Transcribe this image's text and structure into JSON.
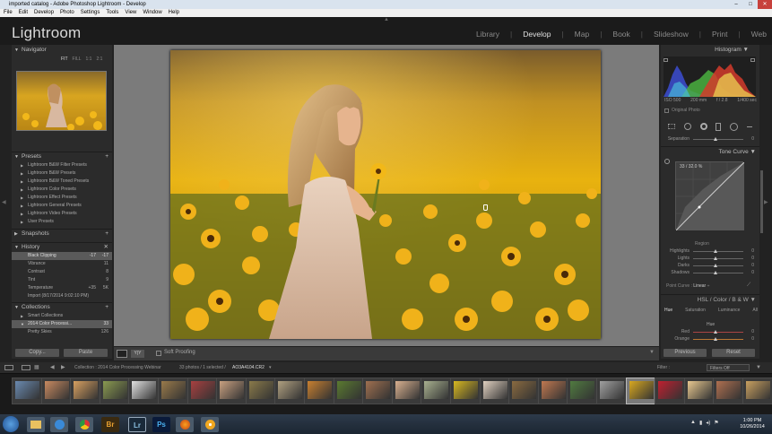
{
  "window": {
    "title": "imported catalog - Adobe Photoshop Lightroom - Develop"
  },
  "menu": [
    "File",
    "Edit",
    "Develop",
    "Photo",
    "Settings",
    "Tools",
    "View",
    "Window",
    "Help"
  ],
  "app_name": "Lightroom",
  "modules": [
    "Library",
    "Develop",
    "Map",
    "Book",
    "Slideshow",
    "Print",
    "Web"
  ],
  "active_module": "Develop",
  "left_panel": {
    "navigator": {
      "title": "Navigator",
      "zoom": [
        "FIT",
        "FILL",
        "1:1",
        "2:1"
      ]
    },
    "presets": {
      "title": "Presets",
      "items": [
        "Lightroom B&W Filter Presets",
        "Lightroom B&W Presets",
        "Lightroom B&W Toned Presets",
        "Lightroom Color Presets",
        "Lightroom Effect Presets",
        "Lightroom General Presets",
        "Lightroom Video Presets",
        "User Presets"
      ]
    },
    "snapshots": {
      "title": "Snapshots"
    },
    "history": {
      "title": "History",
      "items": [
        {
          "label": "Black Clipping",
          "v1": "-17",
          "v2": "-17"
        },
        {
          "label": "Vibrance",
          "v1": "",
          "v2": "11"
        },
        {
          "label": "Contrast",
          "v1": "",
          "v2": "8"
        },
        {
          "label": "Tint",
          "v1": "",
          "v2": "9"
        },
        {
          "label": "Temperature",
          "v1": "+35",
          "v2": "5K"
        },
        {
          "label": "Import (8/17/2014 9:02:10 PM)",
          "v1": "",
          "v2": ""
        }
      ]
    },
    "collections": {
      "title": "Collections",
      "items": [
        {
          "label": "Smart Collections",
          "count": ""
        },
        {
          "label": "2014 Color Processi...",
          "count": "33"
        },
        {
          "label": "Pretty Skies",
          "count": "126"
        }
      ]
    },
    "copy_button": "Copy...",
    "paste_button": "Paste"
  },
  "toolbar": {
    "soft_proofing": "Soft Proofing"
  },
  "right_panel": {
    "histogram": {
      "title": "Histogram",
      "iso": "ISO 500",
      "focal": "200 mm",
      "aperture": "f / 2.8",
      "shutter": "1/400 sec",
      "original_photo": "Original Photo"
    },
    "separation": {
      "label": "Separation",
      "value": "0"
    },
    "tone_curve": {
      "title": "Tone Curve",
      "readout": "33 / 32.0 %",
      "region_label": "Region",
      "sliders": [
        {
          "label": "Highlights",
          "value": "0"
        },
        {
          "label": "Lights",
          "value": "0"
        },
        {
          "label": "Darks",
          "value": "0"
        },
        {
          "label": "Shadows",
          "value": "0"
        }
      ],
      "point_curve_label": "Point Curve :",
      "point_curve_value": "Linear"
    },
    "hsl": {
      "title": "HSL / Color / B & W",
      "tabs": [
        "Hue",
        "Saturation",
        "Luminance",
        "All"
      ],
      "sub": "Hue",
      "sliders": [
        {
          "label": "Red",
          "value": "0"
        },
        {
          "label": "Orange",
          "value": "0"
        }
      ]
    },
    "previous_button": "Previous",
    "reset_button": "Reset"
  },
  "filmstrip_bar": {
    "collection": "Collection : 2014 Color Processing Webinar",
    "count": "33 photos / 1 selected /",
    "filename": "AO3A4104.CR2",
    "filter_label": "Filter :",
    "filter_value": "Filters Off"
  },
  "clock": {
    "time": "1:00 PM",
    "date": "10/26/2014"
  },
  "taskbar_icons": [
    "windows-start",
    "explorer",
    "ie",
    "chrome",
    "bridge",
    "lightroom",
    "photoshop",
    "firefox",
    "app"
  ],
  "taskbar_labels": {
    "bridge": "Br",
    "lightroom": "Lr",
    "photoshop": "Ps"
  }
}
